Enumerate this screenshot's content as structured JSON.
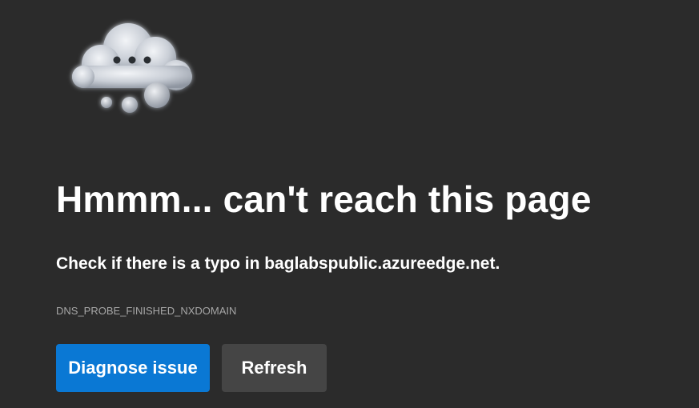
{
  "error_page": {
    "illustration": "thinking-cloud-icon",
    "title": "Hmmm... can't reach this page",
    "message": "Check if there is a typo in baglabspublic.azureedge.net.",
    "error_code": "DNS_PROBE_FINISHED_NXDOMAIN",
    "buttons": {
      "diagnose_label": "Diagnose issue",
      "refresh_label": "Refresh"
    }
  },
  "colors": {
    "background": "#2b2b2b",
    "primary_button": "#0a78d4",
    "secondary_button": "#454545",
    "error_code_text": "#a6a6a6"
  }
}
